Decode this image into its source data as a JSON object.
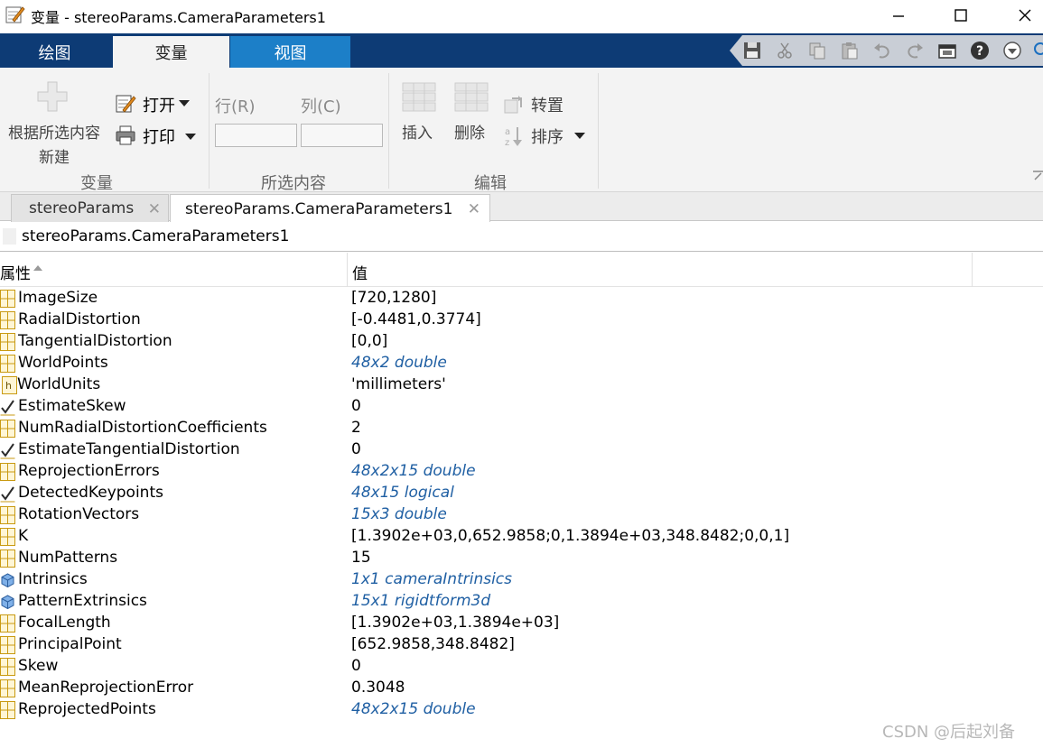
{
  "window": {
    "title": "变量 - stereoParams.CameraParameters1",
    "minimize_icon": "minimize-icon",
    "maximize_icon": "maximize-icon",
    "close_icon": "close-icon"
  },
  "ribbon_tabs": [
    "绘图",
    "变量",
    "视图"
  ],
  "ribbon": {
    "variable_group": {
      "new_from_selection_line1": "根据所选内容",
      "new_from_selection_line2": "新建",
      "open_label": "打开",
      "print_label": "打印",
      "group_label": "变量"
    },
    "selection_group": {
      "row_label": "行(R)",
      "col_label": "列(C)",
      "row_value": "",
      "col_value": "",
      "group_label": "所选内容"
    },
    "edit_group": {
      "insert_label": "插入",
      "delete_label": "删除",
      "transpose_label": "转置",
      "sort_label": "排序",
      "group_label": "编辑"
    }
  },
  "doc_tabs": [
    {
      "label": "stereoParams",
      "active": false
    },
    {
      "label": "stereoParams.CameraParameters1",
      "active": true
    }
  ],
  "breadcrumb": "stereoParams.CameraParameters1",
  "table": {
    "headers": [
      "属性",
      "值"
    ],
    "rows": [
      {
        "name": "ImageSize",
        "value": "[720,1280]",
        "icon": "grid",
        "link": false
      },
      {
        "name": "RadialDistortion",
        "value": "[-0.4481,0.3774]",
        "icon": "grid",
        "link": false
      },
      {
        "name": "TangentialDistortion",
        "value": "[0,0]",
        "icon": "grid",
        "link": false
      },
      {
        "name": "WorldPoints",
        "value": "48x2 double",
        "icon": "grid",
        "link": true
      },
      {
        "name": "WorldUnits",
        "value": "'millimeters'",
        "icon": "text",
        "link": false
      },
      {
        "name": "EstimateSkew",
        "value": "0",
        "icon": "check",
        "link": false
      },
      {
        "name": "NumRadialDistortionCoefficients",
        "value": "2",
        "icon": "grid",
        "link": false
      },
      {
        "name": "EstimateTangentialDistortion",
        "value": "0",
        "icon": "check",
        "link": false
      },
      {
        "name": "ReprojectionErrors",
        "value": "48x2x15 double",
        "icon": "grid",
        "link": true
      },
      {
        "name": "DetectedKeypoints",
        "value": "48x15 logical",
        "icon": "check",
        "link": true
      },
      {
        "name": "RotationVectors",
        "value": "15x3 double",
        "icon": "grid",
        "link": true
      },
      {
        "name": "K",
        "value": "[1.3902e+03,0,652.9858;0,1.3894e+03,348.8482;0,0,1]",
        "icon": "grid",
        "link": false
      },
      {
        "name": "NumPatterns",
        "value": "15",
        "icon": "grid",
        "link": false
      },
      {
        "name": "Intrinsics",
        "value": "1x1 cameraIntrinsics",
        "icon": "object",
        "link": true
      },
      {
        "name": "PatternExtrinsics",
        "value": "15x1 rigidtform3d",
        "icon": "object",
        "link": true
      },
      {
        "name": "FocalLength",
        "value": "[1.3902e+03,1.3894e+03]",
        "icon": "grid",
        "link": false
      },
      {
        "name": "PrincipalPoint",
        "value": "[652.9858,348.8482]",
        "icon": "grid",
        "link": false
      },
      {
        "name": "Skew",
        "value": "0",
        "icon": "grid",
        "link": false
      },
      {
        "name": "MeanReprojectionError",
        "value": "0.3048",
        "icon": "grid",
        "link": false
      },
      {
        "name": "ReprojectedPoints",
        "value": "48x2x15 double",
        "icon": "grid",
        "link": true
      }
    ]
  },
  "watermark": "CSDN @后起刘备",
  "colors": {
    "tabbar": "#0d3b75",
    "view_tab": "#1c7fc8",
    "link": "#1f5fa3",
    "grid_icon": "#e8b923",
    "object_icon": "#3a77c2"
  }
}
